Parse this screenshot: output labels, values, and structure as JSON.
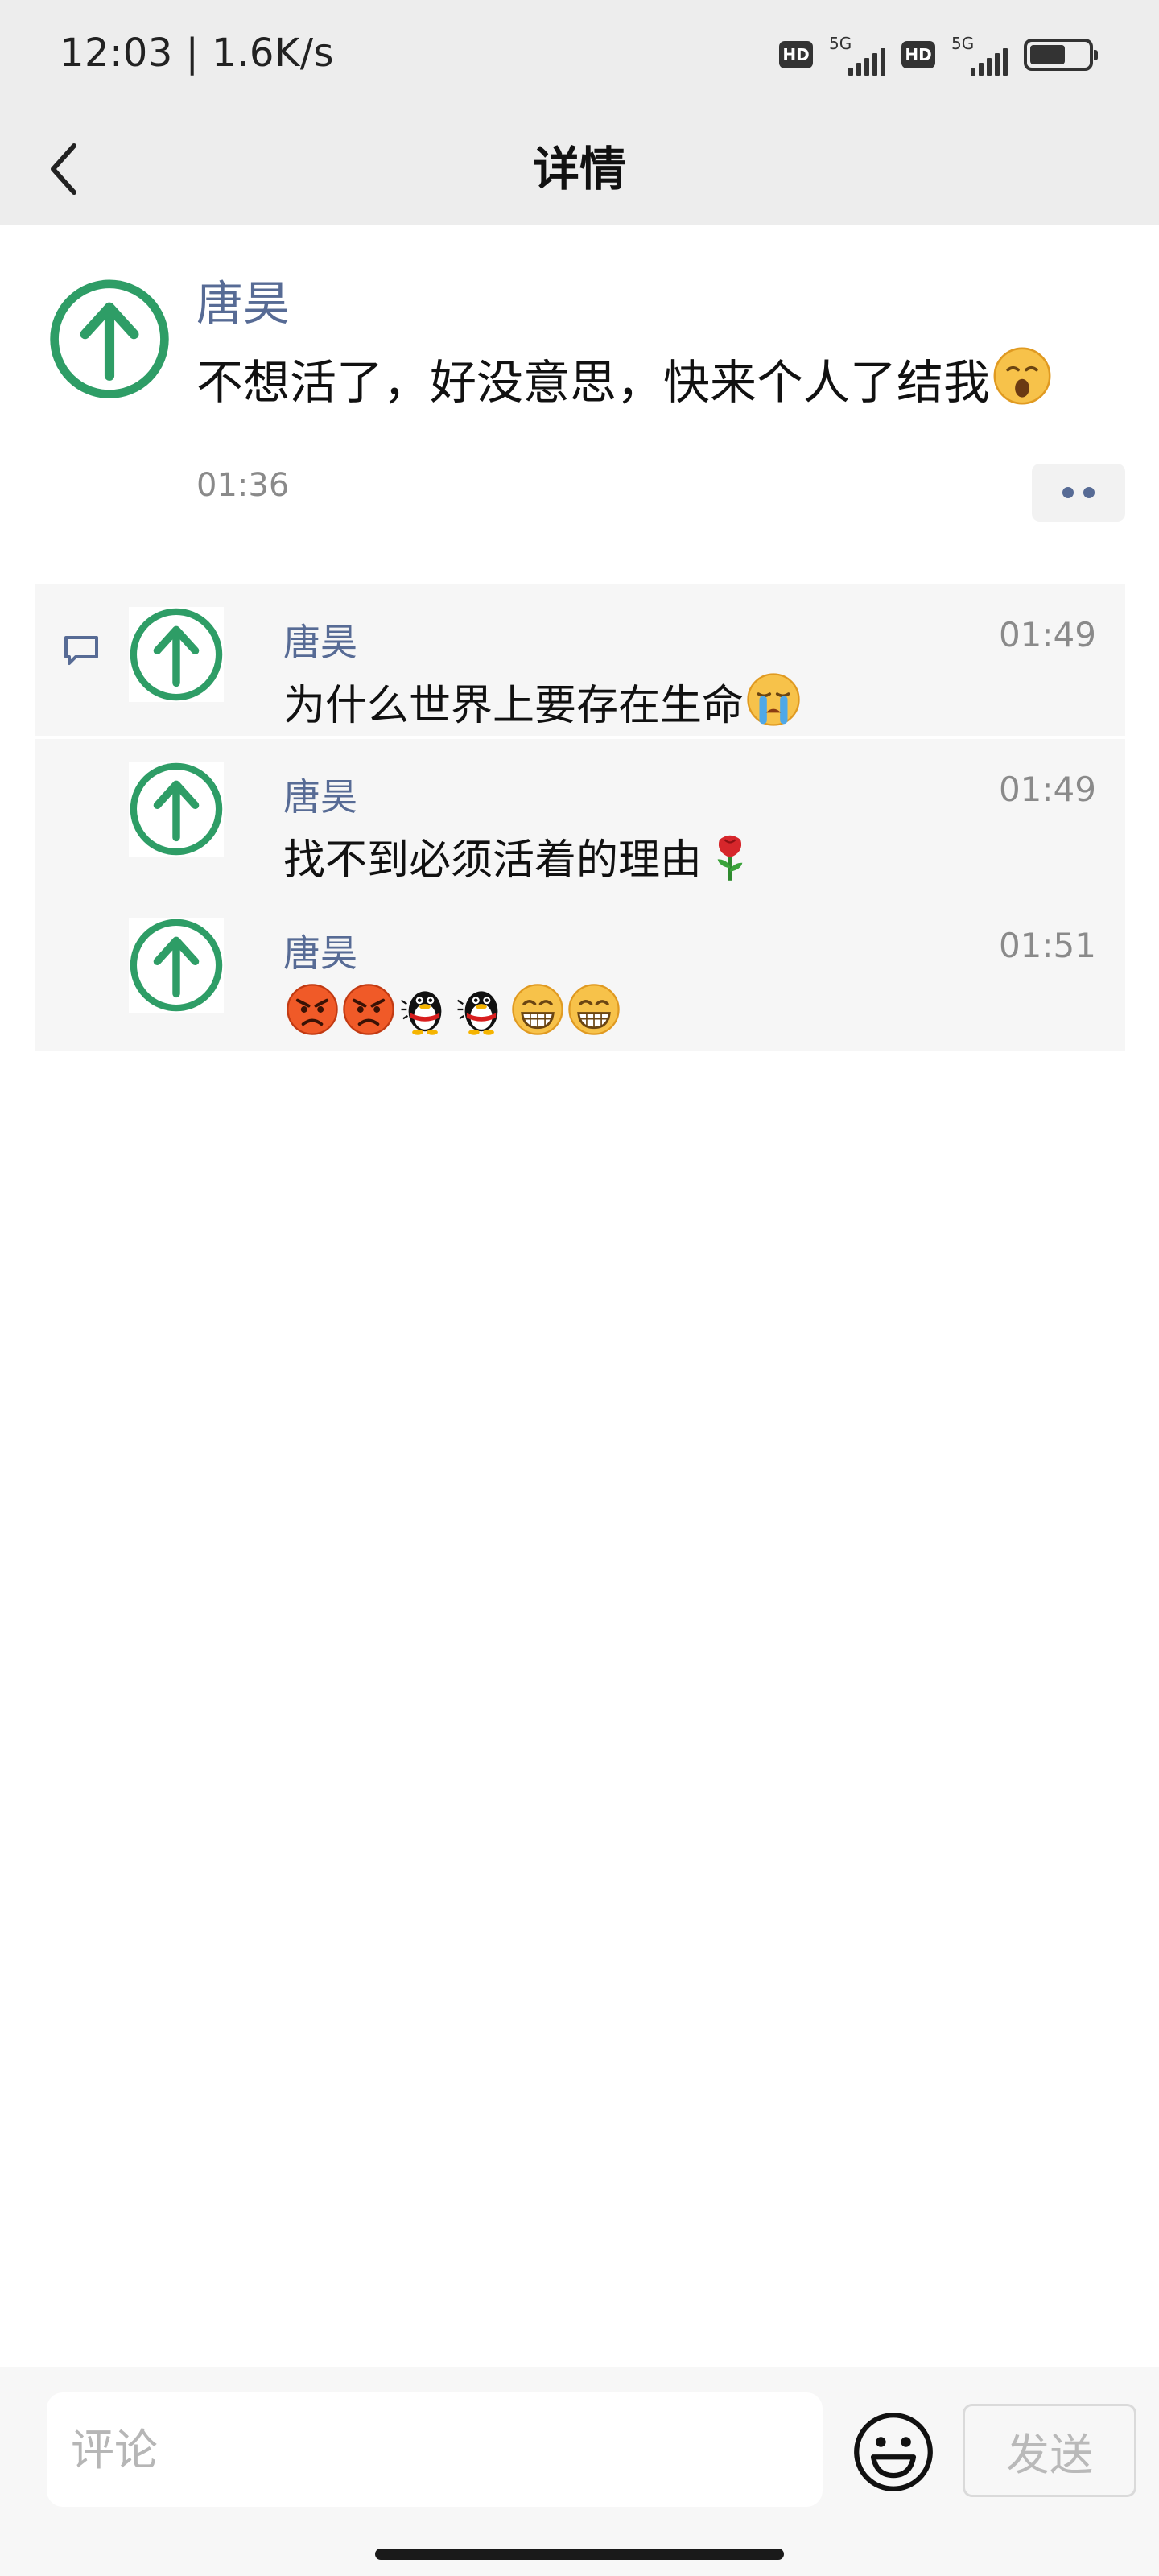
{
  "status_bar": {
    "time": "12:03 | 1.6K/s",
    "hd_label": "HD",
    "network_label": "5G"
  },
  "nav": {
    "title": "详情"
  },
  "post": {
    "author": "唐昊",
    "content": "不想活了，好没意思，快来个人了结我",
    "content_emoji": "yawning-face-emoji",
    "time": "01:36"
  },
  "comments": [
    {
      "author": "唐昊",
      "time": "01:49",
      "text": "为什么世界上要存在生命",
      "emoji": [
        "loudly-crying-face-emoji"
      ]
    },
    {
      "author": "唐昊",
      "time": "01:49",
      "text": "找不到必须活着的理由",
      "emoji": [
        "rose-emoji"
      ]
    },
    {
      "author": "唐昊",
      "time": "01:51",
      "text": "",
      "emoji": [
        "angry-face-emoji",
        "angry-face-emoji",
        "qq-penguin-emoji",
        "qq-penguin-emoji",
        "grinning-face-emoji",
        "grinning-face-emoji"
      ]
    }
  ],
  "input_bar": {
    "placeholder": "评论",
    "send_label": "发送"
  },
  "colors": {
    "header_bg": "#ededed",
    "author_link": "#576b95",
    "avatar_green": "#2e9d66",
    "comment_bg": "#f6f6f6"
  }
}
